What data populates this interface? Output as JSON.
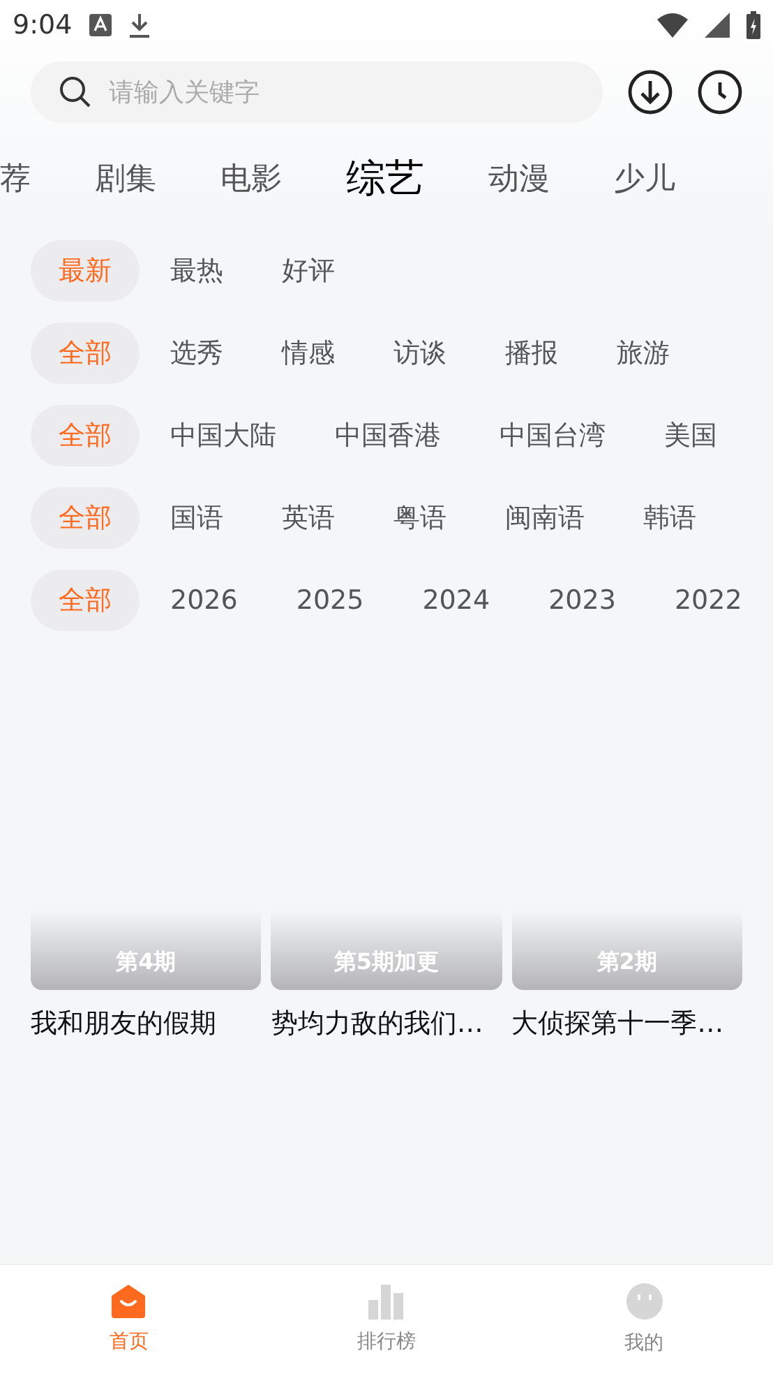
{
  "status_bar": {
    "time": "9:04"
  },
  "search": {
    "placeholder": "请输入关键字"
  },
  "tabs": [
    {
      "label": "荐",
      "selected": false
    },
    {
      "label": "剧集",
      "selected": false
    },
    {
      "label": "电影",
      "selected": false
    },
    {
      "label": "综艺",
      "selected": true
    },
    {
      "label": "动漫",
      "selected": false
    },
    {
      "label": "少儿",
      "selected": false
    }
  ],
  "filters": [
    {
      "options": [
        {
          "label": "最新",
          "selected": true
        },
        {
          "label": "最热",
          "selected": false
        },
        {
          "label": "好评",
          "selected": false
        }
      ]
    },
    {
      "options": [
        {
          "label": "全部",
          "selected": true
        },
        {
          "label": "选秀",
          "selected": false
        },
        {
          "label": "情感",
          "selected": false
        },
        {
          "label": "访谈",
          "selected": false
        },
        {
          "label": "播报",
          "selected": false
        },
        {
          "label": "旅游",
          "selected": false
        }
      ]
    },
    {
      "options": [
        {
          "label": "全部",
          "selected": true
        },
        {
          "label": "中国大陆",
          "selected": false
        },
        {
          "label": "中国香港",
          "selected": false
        },
        {
          "label": "中国台湾",
          "selected": false
        },
        {
          "label": "美国",
          "selected": false
        }
      ]
    },
    {
      "options": [
        {
          "label": "全部",
          "selected": true
        },
        {
          "label": "国语",
          "selected": false
        },
        {
          "label": "英语",
          "selected": false
        },
        {
          "label": "粤语",
          "selected": false
        },
        {
          "label": "闽南语",
          "selected": false
        },
        {
          "label": "韩语",
          "selected": false
        }
      ]
    },
    {
      "options": [
        {
          "label": "全部",
          "selected": true
        },
        {
          "label": "2026",
          "selected": false
        },
        {
          "label": "2025",
          "selected": false
        },
        {
          "label": "2024",
          "selected": false
        },
        {
          "label": "2023",
          "selected": false
        },
        {
          "label": "2022",
          "selected": false
        }
      ]
    }
  ],
  "cards": [
    {
      "badge": "第4期",
      "title": "我和朋友的假期"
    },
    {
      "badge": "第5期加更",
      "title": "势均力敌的我们…"
    },
    {
      "badge": "第2期",
      "title": "大侦探第十一季…"
    }
  ],
  "bottom_nav": [
    {
      "label": "首页",
      "selected": true,
      "kind": "home"
    },
    {
      "label": "排行榜",
      "selected": false,
      "kind": "rank"
    },
    {
      "label": "我的",
      "selected": false,
      "kind": "me"
    }
  ]
}
